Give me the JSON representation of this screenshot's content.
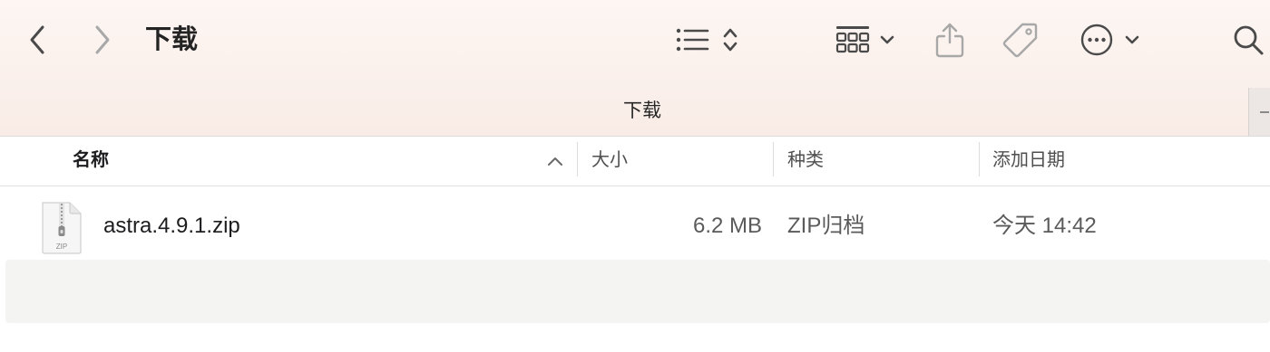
{
  "window": {
    "title": "下载",
    "path_title": "下载"
  },
  "toolbar": {
    "back_icon": "chevron-left-icon",
    "forward_icon": "chevron-right-icon",
    "list_view_icon": "list-icon",
    "sort_icon": "chevron-up-down-icon",
    "group_icon": "grid-icon",
    "share_icon": "share-icon",
    "tag_icon": "tag-icon",
    "more_icon": "ellipsis-circle-icon",
    "search_icon": "search-icon"
  },
  "columns": {
    "name": "名称",
    "size": "大小",
    "kind": "种类",
    "date_added": "添加日期",
    "sort_direction": "ascending"
  },
  "files": [
    {
      "icon": "zip-file-icon",
      "icon_label": "ZIP",
      "name": "astra.4.9.1.zip",
      "size": "6.2 MB",
      "kind": "ZIP归档",
      "date_added": "今天 14:42"
    }
  ],
  "colors": {
    "toolbar_bg": "#f9ece6",
    "icon_dark": "#4a4a4a",
    "icon_disabled": "#a8a8a8",
    "empty_row_bg": "#f4f4f3"
  }
}
